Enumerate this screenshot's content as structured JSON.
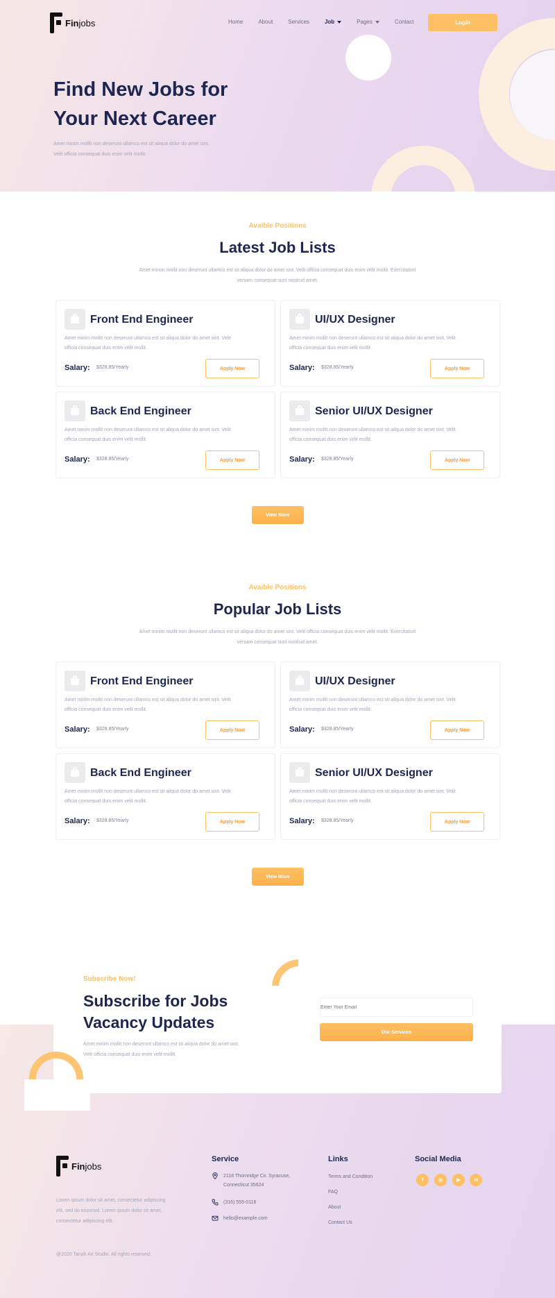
{
  "brand": {
    "name_bold": "Fin",
    "name_rest": "jobs"
  },
  "nav": {
    "items": [
      "Home",
      "About",
      "Services",
      "Job",
      "Pages",
      "Contact"
    ],
    "active": "Job",
    "login_label": "Login"
  },
  "hero": {
    "title": "Find New Jobs for Your Next Career",
    "subtitle": "Amet minim mollit non deserunt ullamco est sit aliqua dolor do amet sint. Velit officia consequat duis enim velit mollit."
  },
  "latest": {
    "kicker": "Avaible Positions",
    "title": "Latest Job Lists",
    "desc": "Amet minim mollit non deserunt ullamco est sit aliqua dolor do amet sint. Velit officia consequat duis enim velit mollit. Exercitation veniam consequat sunt nostrud amet.",
    "view_more": "View More",
    "jobs": [
      {
        "title": "Front End Engineer",
        "desc": "Amet minim mollit non deserunt ullamco est sit aliqua dolor do amet sint. Velit officia consequat duis enim velit mollit.",
        "salary_label": "Salary:",
        "salary": "$328.85/Yearly",
        "apply": "Apply Now"
      },
      {
        "title": "UI/UX Designer",
        "desc": "Amet minim mollit non deserunt ullamco est sit aliqua dolor do amet sint. Velit officia consequat duis enim velit mollit.",
        "salary_label": "Salary:",
        "salary": "$328.85/Yearly",
        "apply": "Apply Now"
      },
      {
        "title": "Back End Engineer",
        "desc": "Amet minim mollit non deserunt ullamco est sit aliqua dolor do amet sint. Velit officia consequat duis enim velit mollit.",
        "salary_label": "Salary:",
        "salary": "$328.85/Yearly",
        "apply": "Apply Now"
      },
      {
        "title": "Senior UI/UX Designer",
        "desc": "Amet minim mollit non deserunt ullamco est sit aliqua dolor do amet sint. Velit officia consequat duis enim velit mollit.",
        "salary_label": "Salary:",
        "salary": "$328.85/Yearly",
        "apply": "Apply Now"
      }
    ]
  },
  "popular": {
    "kicker": "Avaible Positions",
    "title": "Popular Job Lists",
    "desc": "Amet minim mollit non deserunt ullamco est sit aliqua dolor do amet sint. Velit officia consequat duis enim velit mollit. Exercitation veniam consequat sunt nostrud amet.",
    "view_more": "View More",
    "jobs": [
      {
        "title": "Front End Engineer",
        "desc": "Amet minim mollit non deserunt ullamco est sit aliqua dolor do amet sint. Velit officia consequat duis enim velit mollit.",
        "salary_label": "Salary:",
        "salary": "$328.85/Yearly",
        "apply": "Apply Now"
      },
      {
        "title": "UI/UX Designer",
        "desc": "Amet minim mollit non deserunt ullamco est sit aliqua dolor do amet sint. Velit officia consequat duis enim velit mollit.",
        "salary_label": "Salary:",
        "salary": "$328.85/Yearly",
        "apply": "Apply Now"
      },
      {
        "title": "Back End Engineer",
        "desc": "Amet minim mollit non deserunt ullamco est sit aliqua dolor do amet sint. Velit officia consequat duis enim velit mollit.",
        "salary_label": "Salary:",
        "salary": "$328.85/Yearly",
        "apply": "Apply Now"
      },
      {
        "title": "Senior UI/UX Designer",
        "desc": "Amet minim mollit non deserunt ullamco est sit aliqua dolor do amet sint. Velit officia consequat duis enim velit mollit.",
        "salary_label": "Salary:",
        "salary": "$328.85/Yearly",
        "apply": "Apply Now"
      }
    ]
  },
  "subscribe": {
    "kicker": "Subscribe Now!",
    "title": "Subscribe for Jobs Vacancy Updates",
    "desc": "Amet minim mollit non deserunt ullamco est sit aliqua dolor do amet sint. Velit officia consequat duis enim velit mollit.",
    "email_placeholder": "Enter Your Email",
    "button": "Our Services"
  },
  "footer": {
    "desc": "Lorem ipsum dolor sit amet, consectetur adipiscing elit, sed do eiusmod. Lorem ipsum dolor sit amet, consectetur adipiscing elit.",
    "copyright": "@2020 Tanah Air Studio. All rights reserved.",
    "service": {
      "heading": "Service",
      "address": "2118 Thornridge Cir. Syracuse, Connecticut 35624",
      "phone": "(316) 555-0116",
      "email": "hello@example.com"
    },
    "links": {
      "heading": "Links",
      "items": [
        "Terms and Condition",
        "FAQ",
        "About",
        "Contact Us"
      ]
    },
    "social": {
      "heading": "Social Media",
      "icons": [
        "facebook-icon",
        "instagram-icon",
        "youtube-icon",
        "linkedin-icon"
      ],
      "glyphs": [
        "f",
        "◎",
        "▶",
        "in"
      ]
    }
  },
  "colors": {
    "accent": "#fec064",
    "navy": "#1d2550",
    "muted": "#a4a6b8"
  }
}
